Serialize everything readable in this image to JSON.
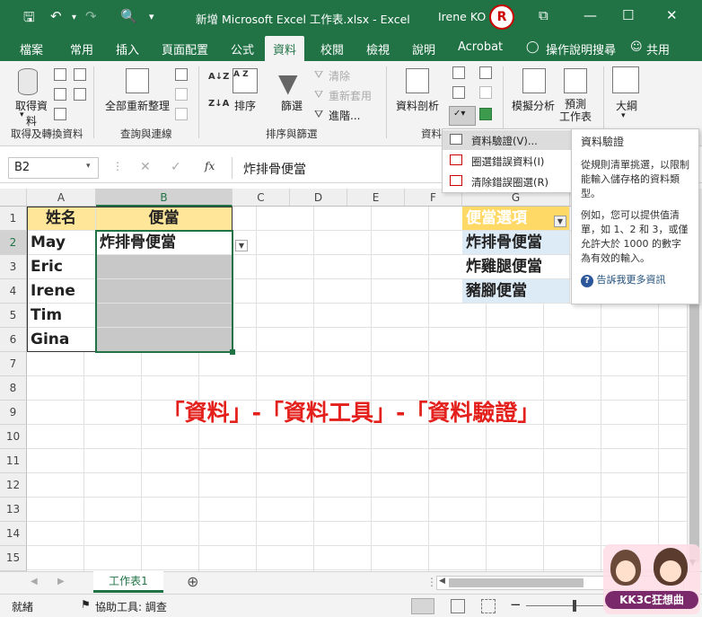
{
  "titlebar": {
    "title": "新增 Microsoft Excel 工作表.xlsx  -  Excel",
    "user": "Irene KO",
    "avatar_text": "R",
    "save_icon": "save-icon",
    "undo_icon": "undo-icon",
    "redo_icon": "redo-icon",
    "preview_icon": "print-preview-icon",
    "customize_icon": "customize-qat-icon"
  },
  "tabs": [
    "檔案",
    "常用",
    "插入",
    "頁面配置",
    "公式",
    "資料",
    "校閱",
    "檢視",
    "說明",
    "Acrobat",
    "操作說明搜尋",
    "共用"
  ],
  "active_tab": "資料",
  "ribbon": {
    "get_data": "取得資料",
    "group_get": "取得及轉換資料",
    "refresh_all": "全部重新整理",
    "group_query": "查詢與連線",
    "sort": "排序",
    "filter": "篩選",
    "clear": "清除",
    "reapply": "重新套用",
    "advanced": "進階...",
    "group_sort": "排序與篩選",
    "text_to_columns": "資料剖析",
    "group_data_tools": "資料",
    "what_if": "模擬分析",
    "forecast_sheet": "預測\n工作表",
    "outline": "大綱",
    "az_label": "A Z",
    "za_label": "Z A",
    "sort_az_label": "A↓Z",
    "sort_za_label": "Z↓A"
  },
  "formula_bar": {
    "name_box": "B2",
    "cancel": "✕",
    "enter": "✓",
    "fx": "fx",
    "value": "炸排骨便當"
  },
  "columns": [
    "A",
    "B",
    "C",
    "D",
    "E",
    "F",
    "G"
  ],
  "rows": [
    "1",
    "2",
    "3",
    "4",
    "5",
    "6",
    "7",
    "8",
    "9",
    "10",
    "11",
    "12",
    "13",
    "14",
    "15"
  ],
  "cells": {
    "A1": "姓名",
    "B1": "便當",
    "A2": "May",
    "B2": "炸排骨便當",
    "A3": "Eric",
    "A4": "Irene",
    "A5": "Tim",
    "A6": "Gina",
    "G1": "便當選項",
    "G2": "炸排骨便當",
    "G3": "炸雞腿便當",
    "G4": "豬腳便當"
  },
  "dropdown": {
    "items": [
      "資料驗證(V)...",
      "圈選錯誤資料(I)",
      "清除錯誤圈選(R)"
    ]
  },
  "tooltip": {
    "title": "資料驗證",
    "p1": "從規則清單挑選，以限制能輸入儲存格的資料類型。",
    "p2": "例如，您可以提供值清單，如 1、2 和 3，或僅允許大於 1000 的數字為有效的輸入。",
    "link": "告訴我更多資訊"
  },
  "caption": "「資料」-「資料工具」-「資料驗證」",
  "sheet_tab": "工作表1",
  "status": {
    "ready": "就緒",
    "accessibility": "協助工具: 調查"
  },
  "watermark": "KK3C狂想曲",
  "colors": {
    "excel_green": "#217346",
    "header_fill": "#ffe699",
    "selection_gray": "#c8c8c8",
    "list_fill": "#ddebf7",
    "caption_red": "#e3201b"
  }
}
